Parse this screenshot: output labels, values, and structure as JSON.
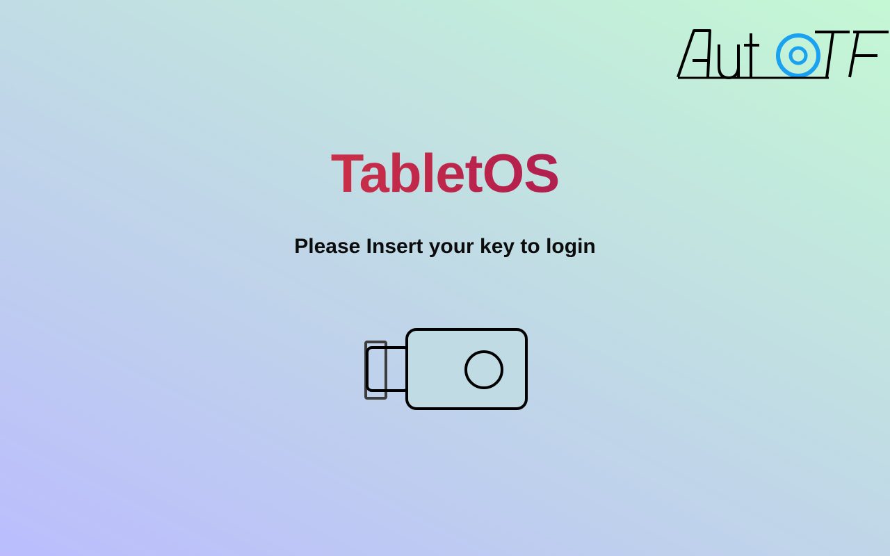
{
  "brand": {
    "logo_text": "AutoTF",
    "logo_ring_color": "#1aa2f0"
  },
  "login": {
    "title": "TabletOS",
    "prompt": "Please Insert your key to login"
  },
  "icons": {
    "key": "usb-security-key-icon"
  },
  "colors": {
    "title_gradient_start": "#ee4a3e",
    "title_gradient_end": "#8a1060",
    "text": "#0c0c0c"
  }
}
